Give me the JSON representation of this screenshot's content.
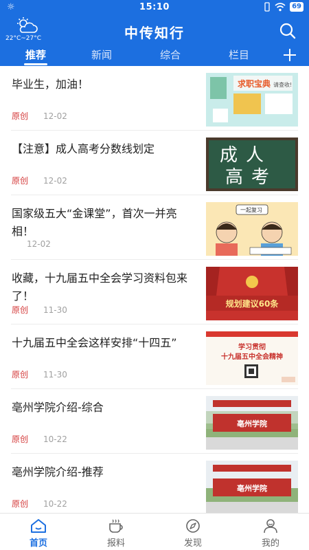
{
  "status_bar": {
    "time": "15:10",
    "battery": "69"
  },
  "header": {
    "title": "中传知行",
    "temperature": "22°C~27°C"
  },
  "tabs": [
    "推荐",
    "新闻",
    "综合",
    "栏目"
  ],
  "colors": {
    "brand": "#1c6fe0",
    "source": "#d43b3b"
  },
  "articles": [
    {
      "title": "毕业生，加油！",
      "source": "原创",
      "date": "12-02",
      "thumb_text": "求职宝典",
      "thumb_extra": "请查收!"
    },
    {
      "title": "【注意】成人高考分数线划定",
      "source": "原创",
      "date": "12-02",
      "thumb_line1": "成人",
      "thumb_line2": "高考"
    },
    {
      "title": "国家级五大“金课堂”，首次一并亮相！",
      "source": "",
      "date": "12-02",
      "thumb_text": "一起复习",
      "thumb_extra": ""
    },
    {
      "title": "收藏，十九届五中全会学习资料包来了！",
      "source": "原创",
      "date": "11-30",
      "thumb_text": "规划建议60条"
    },
    {
      "title": "十九届五中全会这样安排“十四五”",
      "source": "原创",
      "date": "11-30",
      "thumb_line1": "学习贯彻",
      "thumb_line2": "十九届五中全会精神"
    },
    {
      "title": "亳州学院介绍-综合",
      "source": "原创",
      "date": "10-22",
      "thumb_text": "亳州学院"
    },
    {
      "title": "亳州学院介绍-推荐",
      "source": "原创",
      "date": "10-22",
      "thumb_text": "亳州学院"
    }
  ],
  "bottom_nav": [
    "首页",
    "报料",
    "发现",
    "我的"
  ]
}
